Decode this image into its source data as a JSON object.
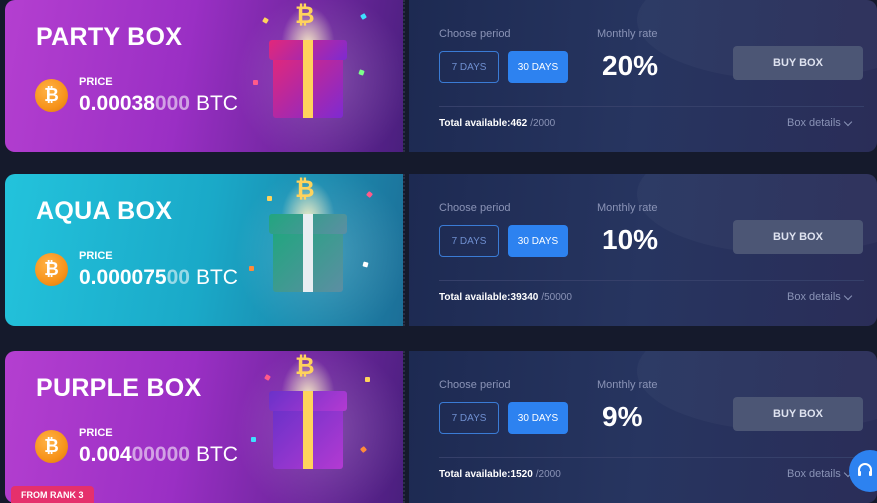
{
  "boxes": [
    {
      "name": "PARTY BOX",
      "price_label": "PRICE",
      "price_main": "0.00038",
      "price_dim": "000",
      "price_unit": "BTC",
      "choose_label": "Choose period",
      "period_7": "7 DAYS",
      "period_30": "30 DAYS",
      "rate_label": "Monthly rate",
      "rate": "20%",
      "buy_label": "BUY BOX",
      "total_label": "Total available:462",
      "total_max": "/2000",
      "details_label": "Box details"
    },
    {
      "name": "AQUA BOX",
      "price_label": "PRICE",
      "price_main": "0.000075",
      "price_dim": "00",
      "price_unit": "BTC",
      "choose_label": "Choose period",
      "period_7": "7 DAYS",
      "period_30": "30 DAYS",
      "rate_label": "Monthly rate",
      "rate": "10%",
      "buy_label": "BUY BOX",
      "total_label": "Total available:39340",
      "total_max": "/50000",
      "details_label": "Box details"
    },
    {
      "name": "PURPLE BOX",
      "price_label": "PRICE",
      "price_main": "0.004",
      "price_dim": "00000",
      "price_unit": "BTC",
      "choose_label": "Choose period",
      "period_7": "7 DAYS",
      "period_30": "30 DAYS",
      "rate_label": "Monthly rate",
      "rate": "9%",
      "buy_label": "BUY BOX",
      "total_label": "Total available:1520",
      "total_max": "/2000",
      "details_label": "Box details"
    }
  ],
  "rank_badge": "FROM RANK 3",
  "coin_symbol": "₿",
  "icons": {
    "coin": "bitcoin-icon",
    "chevron": "chevron-down-icon",
    "support": "headset-icon"
  },
  "colors": {
    "party": "#b43fd0",
    "aqua": "#23c3dc",
    "purple": "#b43fd0",
    "accent_blue": "#2d82f0",
    "rank_badge": "#e5306c"
  }
}
